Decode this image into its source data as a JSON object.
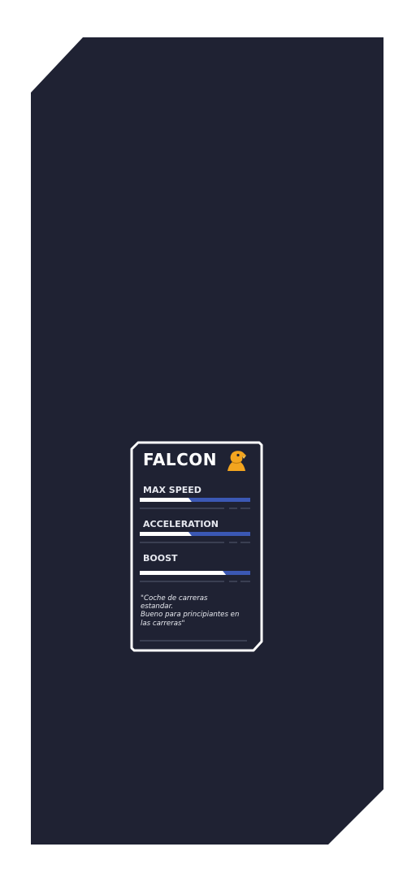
{
  "vehicle": {
    "name": "FALCON",
    "emblem": "eagle-icon",
    "description": "\"Coche de carreras\nestandar.\nBueno para principiantes en\nlas carreras\""
  },
  "stats": [
    {
      "label": "MAX SPEED",
      "base": 0.47,
      "total": 1.0
    },
    {
      "label": "ACCELERATION",
      "base": 0.47,
      "total": 1.0
    },
    {
      "label": "BOOST",
      "base": 0.78,
      "total": 1.0
    }
  ],
  "colors": {
    "background": "#1f2233",
    "bar_base": "#ffffff",
    "bar_upgrade": "#3b58b4",
    "emblem": "#f3a51f"
  }
}
